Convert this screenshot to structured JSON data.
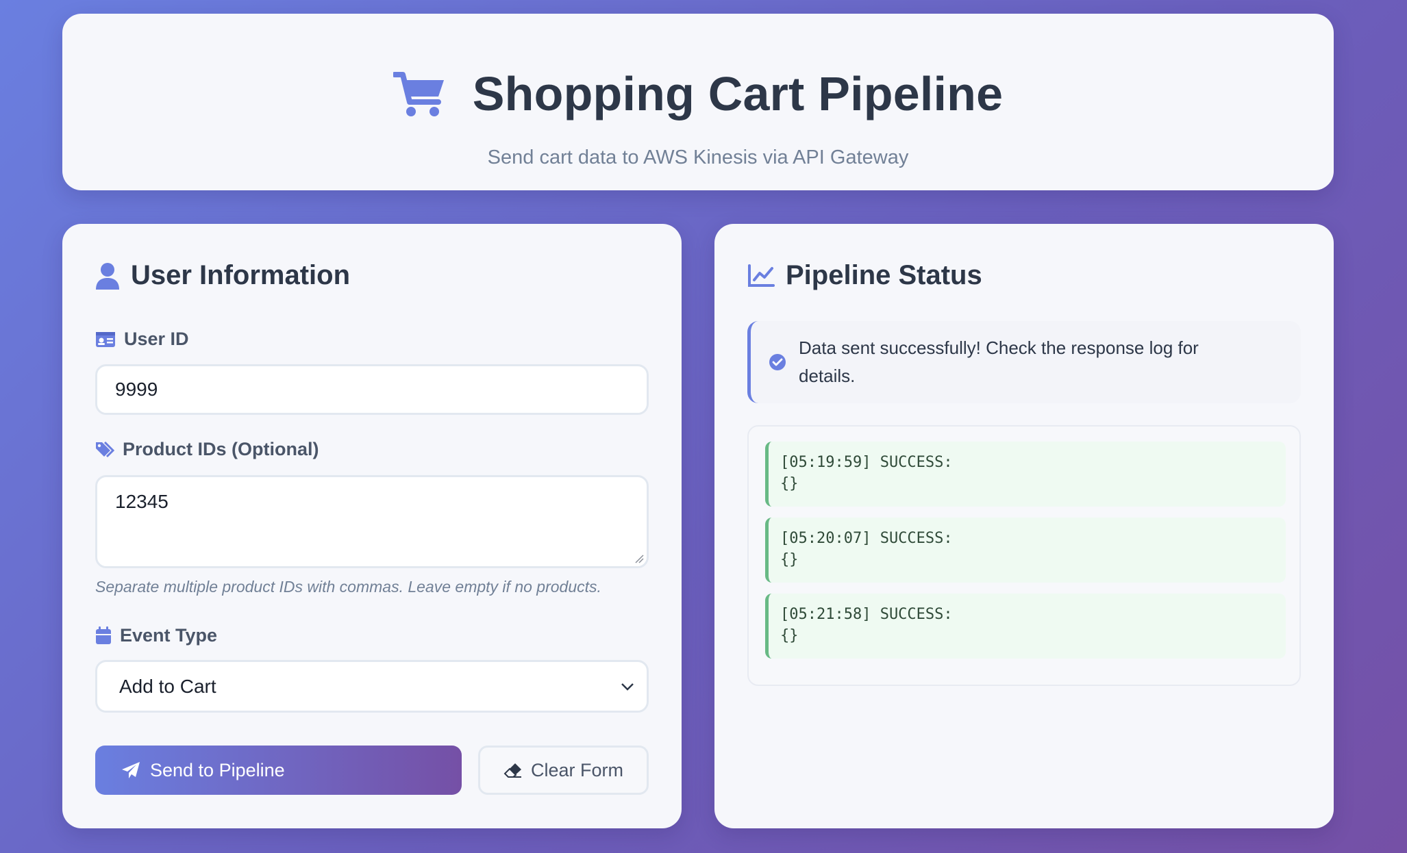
{
  "header": {
    "title": "Shopping Cart Pipeline",
    "subtitle": "Send cart data to AWS Kinesis via API Gateway",
    "icon": "shopping-cart-icon"
  },
  "colors": {
    "accent": "#6a7fe0",
    "accent_dark": "#7550a6",
    "title_text": "#2d3748",
    "success": "#68b985"
  },
  "user_form": {
    "title": "User Information",
    "user_id": {
      "label": "User ID",
      "value": "9999"
    },
    "product_ids": {
      "label": "Product IDs (Optional)",
      "value": "12345",
      "hint": "Separate multiple product IDs with commas. Leave empty if no products."
    },
    "event_type": {
      "label": "Event Type",
      "selected": "Add to Cart"
    },
    "send_label": "Send to Pipeline",
    "clear_label": "Clear Form"
  },
  "status": {
    "title": "Pipeline Status",
    "message": "Data sent successfully! Check the response log for details.",
    "log": [
      {
        "time": "[05:19:59] SUCCESS:",
        "body": "{}"
      },
      {
        "time": "[05:20:07] SUCCESS:",
        "body": "{}"
      },
      {
        "time": "[05:21:58] SUCCESS:",
        "body": "{}"
      }
    ]
  }
}
